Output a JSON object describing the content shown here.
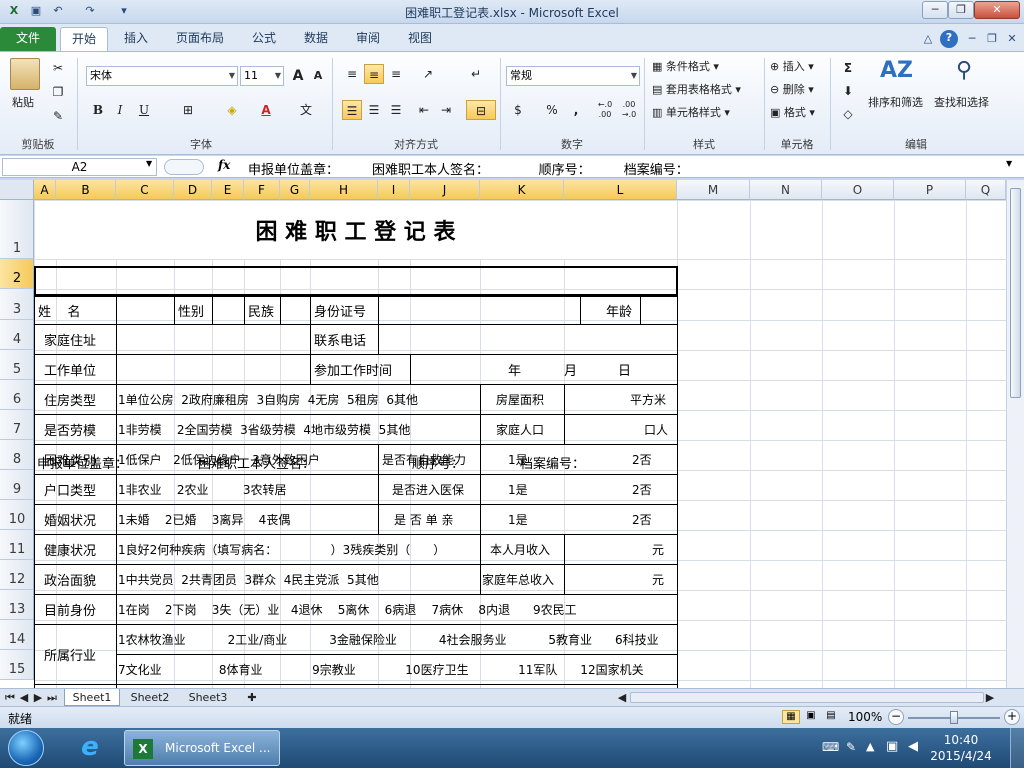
{
  "window": {
    "title": "困难职工登记表.xlsx - Microsoft Excel",
    "min": "─",
    "max": "❐",
    "close": "✕"
  },
  "tabs": [
    "文件",
    "开始",
    "插入",
    "页面布局",
    "公式",
    "数据",
    "审阅",
    "视图"
  ],
  "ribbon": {
    "clipboard": {
      "paste": "粘贴",
      "label": "剪贴板"
    },
    "font": {
      "name": "宋体",
      "size": "11",
      "grow": "A",
      "shrink": "A",
      "bold": "B",
      "italic": "I",
      "underline": "U",
      "label": "字体"
    },
    "align": {
      "label": "对齐方式"
    },
    "number": {
      "format": "常规",
      "percent": "%",
      "comma": ",",
      "inc": "←.0 .00",
      "dec": ".00 →.0",
      "label": "数字"
    },
    "styles": {
      "cond": "条件格式",
      "table": "套用表格格式",
      "cell": "单元格样式",
      "label": "样式"
    },
    "cells": {
      "insert": "插入",
      "delete": "删除",
      "format": "格式",
      "label": "单元格"
    },
    "edit": {
      "sort": "排序和筛选",
      "find": "查找和选择",
      "label": "编辑"
    }
  },
  "formula": {
    "namebox": "A2",
    "fx": "fx",
    "content": "申报单位盖章：        困难职工本人签名：            顺序号：        档案编号："
  },
  "columns": [
    "A",
    "B",
    "C",
    "D",
    "E",
    "F",
    "G",
    "H",
    "I",
    "J",
    "K",
    "L",
    "M",
    "N",
    "O",
    "P",
    "Q"
  ],
  "rows": [
    "1",
    "2",
    "3",
    "4",
    "5",
    "6",
    "7",
    "8",
    "9",
    "10",
    "11",
    "12",
    "13",
    "14",
    "15"
  ],
  "cells": {
    "title": "困 难 职 工 登 记 表",
    "r2": {
      "a": "申报单位盖章：",
      "b": "困难职工本人签名：",
      "c": "顺序号：",
      "d": "档案编号："
    },
    "r3": {
      "a": "姓    名",
      "b": "性别",
      "c": "民族",
      "d": "身份证号",
      "e": "年龄"
    },
    "r4": {
      "a": "家庭住址",
      "b": "联系电话"
    },
    "r5": {
      "a": "工作单位",
      "b": "参加工作时间",
      "c": "年",
      "d": "月",
      "e": "日"
    },
    "r6": {
      "a": "住房类型",
      "b": "1单位公房  2政府廉租房  3自购房  4无房  5租房  6其他",
      "c": "房屋面积",
      "d": "平方米"
    },
    "r7": {
      "a": "是否劳模",
      "b": "1非劳模    2全国劳模  3省级劳模  4地市级劳模  5其他",
      "c": "家庭人口",
      "d": "口人"
    },
    "r8": {
      "a": "困难类别",
      "b": "1低保户   2低保边缘户   3意外致困户",
      "c": "是否有自救能力",
      "d": "1是",
      "e": "2否"
    },
    "r9": {
      "a": "户口类型",
      "b": "1非农业    2农业         3农转居",
      "c": "是否进入医保",
      "d": "1是",
      "e": "2否"
    },
    "r10": {
      "a": "婚姻状况",
      "b": "1未婚    2已婚    3离异    4丧偶",
      "c": "是 否 单 亲",
      "d": "1是",
      "e": "2否"
    },
    "r11": {
      "a": "健康状况",
      "b": "1良好2何种疾病（填写病名：              ）3残疾类别（      ）",
      "c": "本人月收入",
      "d": "元"
    },
    "r12": {
      "a": "政治面貌",
      "b": "1中共党员  2共青团员  3群众  4民主党派  5其他",
      "c": "家庭年总收入",
      "d": "元"
    },
    "r13": {
      "a": "目前身份",
      "b": "1在岗    2下岗    3失（无）业   4退休    5离休    6病退    7病休    8内退      9农民工"
    },
    "r14": {
      "a": "所属行业",
      "b": "1农林牧渔业           2工业/商业           3金融保险业           4社会服务业           5教育业      6科技业"
    },
    "r15": {
      "b": "7文化业               8体育业             9宗教业             10医疗卫生             11军队      12国家机关"
    }
  },
  "sheets": [
    "Sheet1",
    "Sheet2",
    "Sheet3"
  ],
  "status": {
    "ready": "就绪",
    "zoom": "100%",
    "minus": "−",
    "plus": "+"
  },
  "taskbar": {
    "app": "Microsoft Excel ...",
    "time": "10:40",
    "date": "2015/4/24"
  }
}
